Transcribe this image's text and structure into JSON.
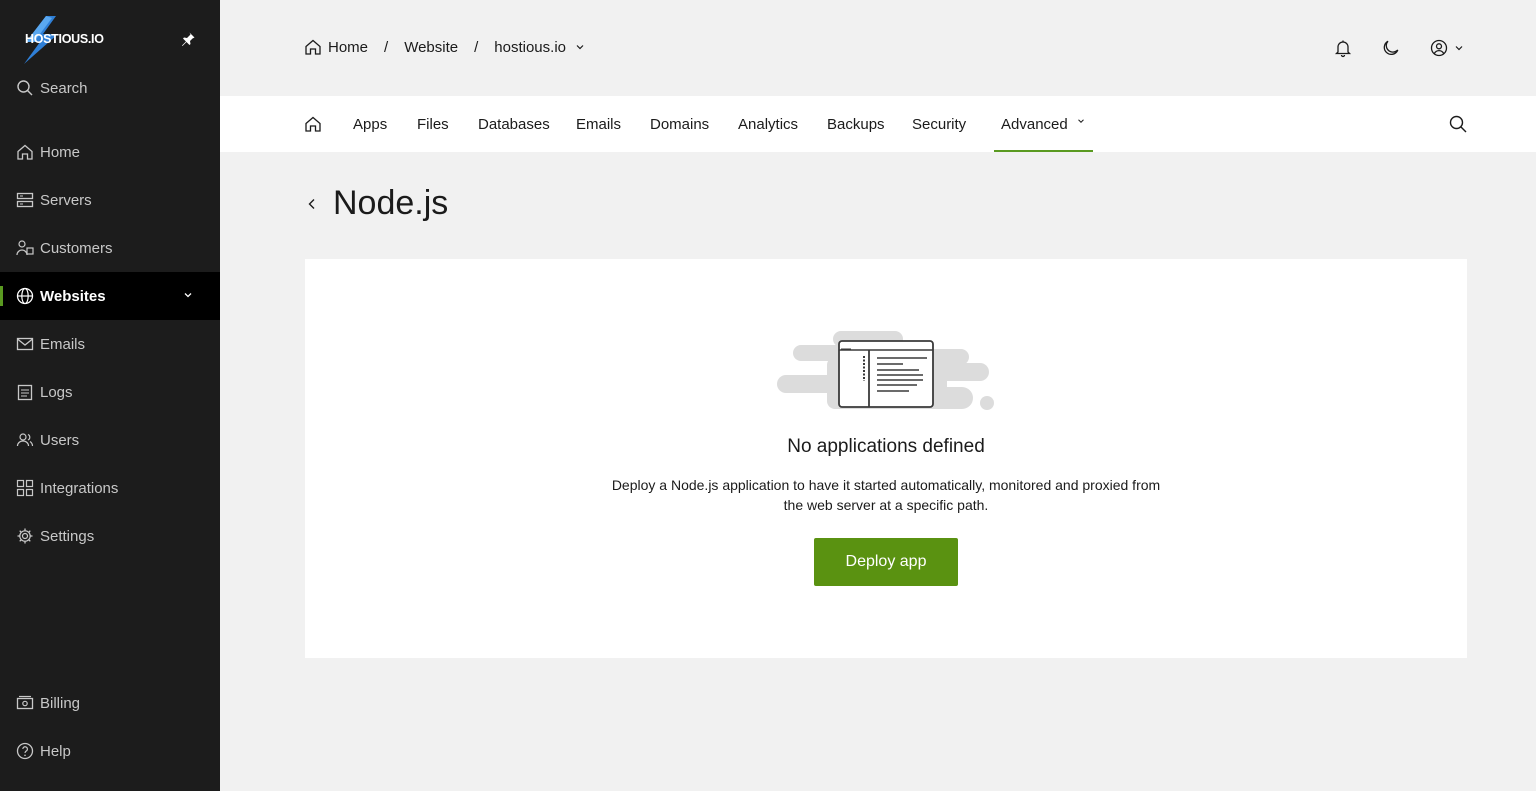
{
  "sidebar": {
    "logo_text": "HOSTIOUS.IO",
    "search_label": "Search",
    "items": [
      {
        "label": "Home",
        "icon": "home-icon"
      },
      {
        "label": "Servers",
        "icon": "server-icon"
      },
      {
        "label": "Customers",
        "icon": "customers-icon"
      },
      {
        "label": "Websites",
        "icon": "globe-icon",
        "active": true
      },
      {
        "label": "Emails",
        "icon": "mail-icon"
      },
      {
        "label": "Logs",
        "icon": "logs-icon"
      },
      {
        "label": "Users",
        "icon": "users-icon"
      },
      {
        "label": "Integrations",
        "icon": "integrations-icon"
      },
      {
        "label": "Settings",
        "icon": "gear-icon"
      }
    ],
    "bottom_items": [
      {
        "label": "Billing",
        "icon": "billing-icon"
      },
      {
        "label": "Help",
        "icon": "help-icon"
      }
    ]
  },
  "breadcrumb": {
    "home": "Home",
    "separator": "/",
    "website": "Website",
    "domain": "hostious.io"
  },
  "tabs": {
    "items": [
      "Apps",
      "Files",
      "Databases",
      "Emails",
      "Domains",
      "Analytics",
      "Backups",
      "Security",
      "Advanced"
    ],
    "active": "Advanced"
  },
  "page": {
    "title": "Node.js"
  },
  "empty_state": {
    "title": "No applications defined",
    "description": "Deploy a Node.js application to have it started automatically, monitored and proxied from the web server at a specific path.",
    "button_label": "Deploy app"
  },
  "colors": {
    "accent": "#5a9a21",
    "button": "#5a9211",
    "sidebar_bg": "#1c1c1c"
  }
}
